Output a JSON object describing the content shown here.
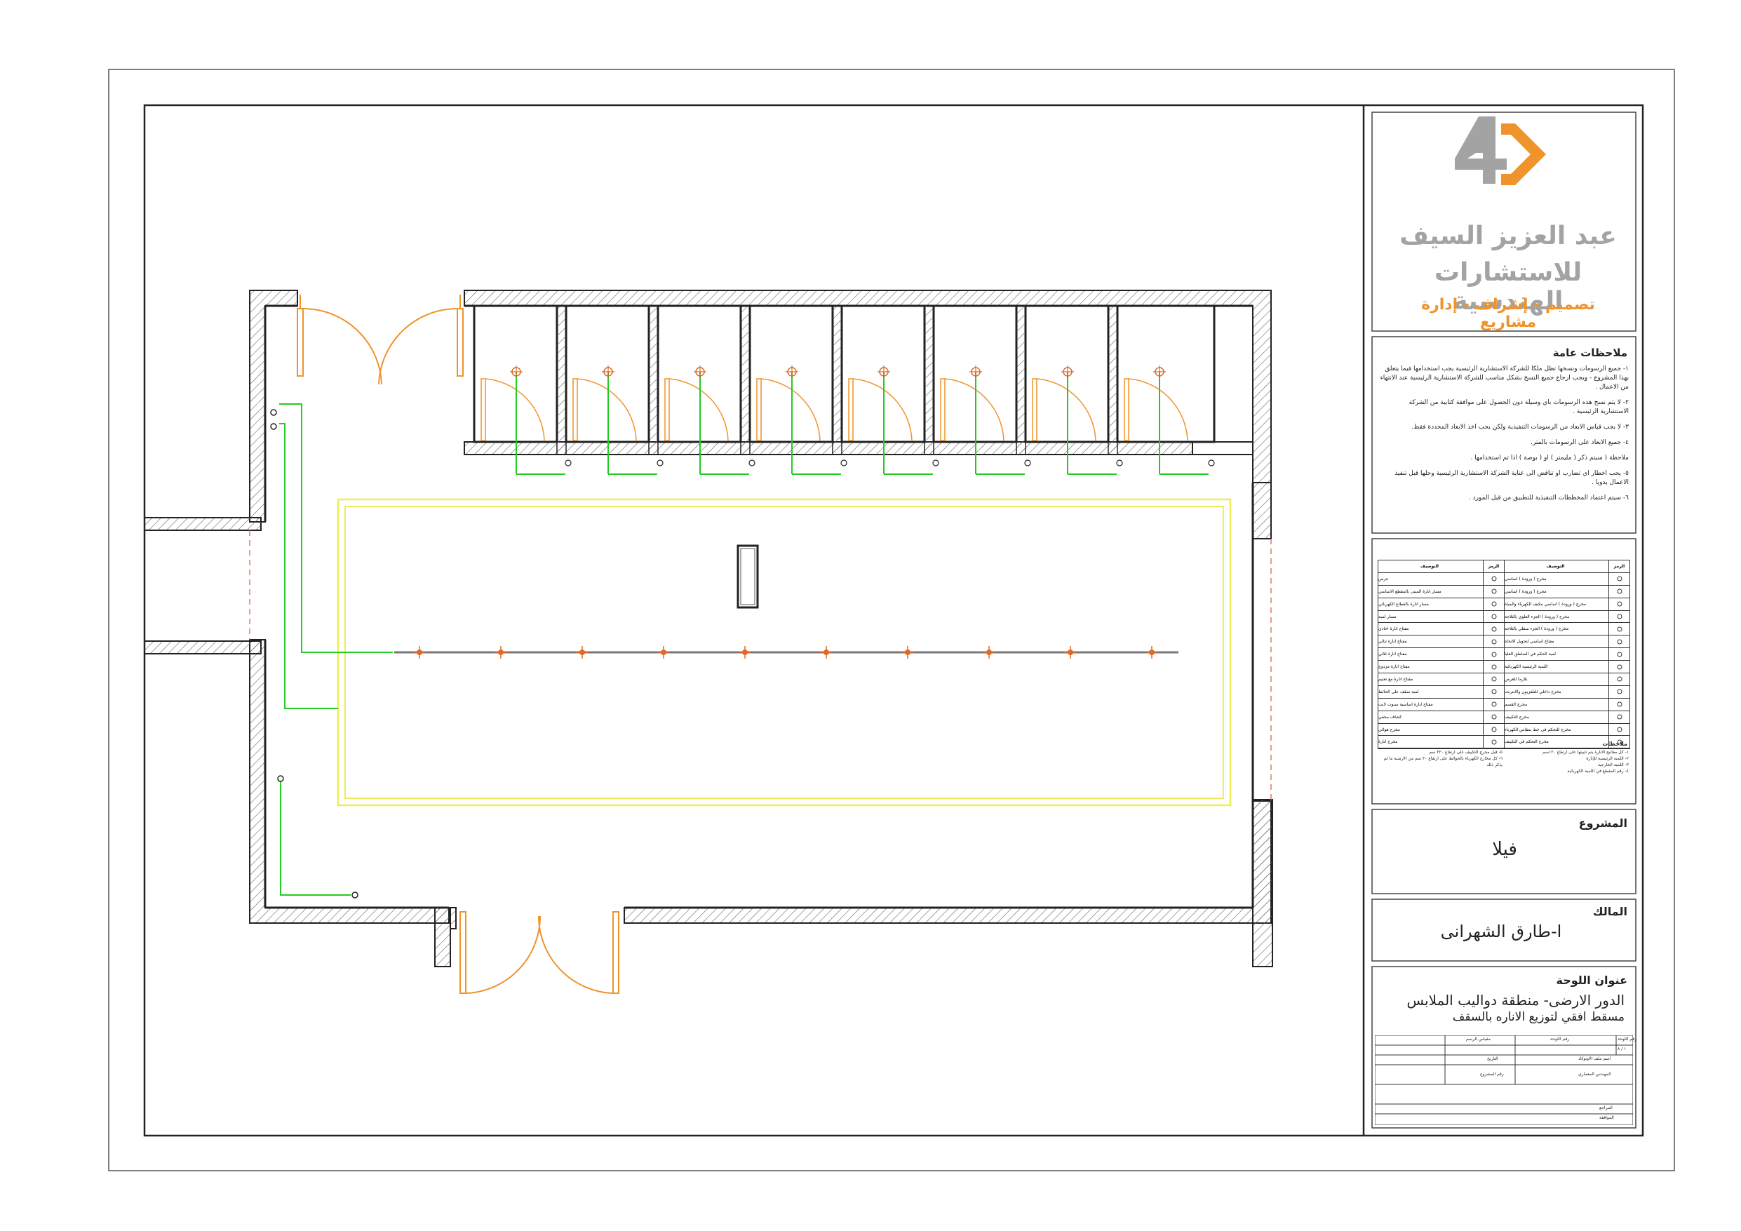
{
  "company": {
    "name_line1": "عبد العزيز السيف",
    "name_line2": "للاستشارات الهندسية",
    "services": "تصميم - إشراف - إدارة مشاريع",
    "logo_icon": "4d-logo-icon",
    "colors": {
      "brand_orange": "#f0932b",
      "brand_gray": "#a3a3a3"
    }
  },
  "notes": {
    "title": "ملاحظات عامة",
    "items": [
      "١- جميع الرسومات ونسخها تظل ملكا للشركة الاستشارية الرئيسية يجب استخدامها فيما يتعلق بهذا المشروع - ويجب ارجاع جميع النسخ بشكل مناسب للشركة الاستشارية الرئيسية عند الانتهاء من الاعمال .",
      "٢- لا يتم نسخ هذه الرسومات باي وسيلة دون الحصول على موافقة كتابية من الشركة الاستشارية الرئيسية .",
      "٣- لا يجب قياس الابعاد من الرسومات التنفيذية ولكن يجب اخذ الابعاد المحددة فقط.",
      "٤- جميع الابعاد على الرسومات بالمتر.",
      "ملاحظة ( سيتم ذكر ( مليمتر ) او ( بوصة ) اذا تم استخدامها .",
      "٥- يجب اخطار اي تضارب او تناقض الى عناية الشركة الاستشارية الرئيسية وحلها قبل تنفيذ الاعمال يدويا .",
      "٦- سيتم اعتماد المخططات التنفيذية للتطبيق من قبل المورد ."
    ]
  },
  "legend": {
    "header_symbol": "الرمز",
    "header_description": "التوصيف",
    "right_rows": [
      "مخرج ( ورودة ) اساسي",
      "مخرج ( ورودة ) اساسي",
      "مخرج ( ورودة ) اساسي مكيف للكهرباء والمياه",
      "مخرج ( ورودة ) الجزء العلوي بالثلاجة",
      "مخرج ( ورودة ) الجزء سفلي بالثلاجة",
      "مفتاح اساسي لتحويل الاتجاه",
      "لمبة الحكم في المناطق العليا",
      "اللمبة الرئيسية الكهربائية",
      "بلازما للعرض",
      "مخرج داخلي للتلفزيون والانترنت",
      "مخرج القسم",
      "مخرج للتكييف",
      "مخرج للتحكم في خط بمقاس الكهرباء",
      "مخرج التحكم في التكييف"
    ],
    "left_rows": [
      "جرس",
      "مسار انارة المبنى بالمقطع الاساسي",
      "مسار انارة بالقطاع الكهربائي",
      "مسار لمبة",
      "مفتاح انارة احادي",
      "مفتاح انارة ثنائي",
      "مفتاح انارة ثلاثي",
      "مفتاح انارة مزدوج",
      "مفتاح انارة مع تعتيم",
      "لمبة سقف على الحائط",
      "مفتاح انارة اساسية سبوت لايت",
      "كشاف مخفي",
      "مخرج هوائي",
      "مخرج انارة"
    ],
    "footnotes_title": "ملاحظات",
    "footnotes_right": [
      "١- كل مفاتيح الانارة يتم تثبيتها على ارتفاع ١٢٠سم",
      "٢- اللمبة الرئيسية للإنارة",
      "٣- اللمبة الخارجية",
      "٤- رقم المقطع في اللمبة الكهربائية"
    ],
    "footnotes_left": [
      "٥- قبل مخرج التكييف على ارتفاع ٢٢٠ سم",
      "٦- كل مخارج الكهرباء بالحوائط على ارتفاع ٣٠ سم من الارضية ما لم يذكر ذلك"
    ]
  },
  "project": {
    "label": "المشروع",
    "value": "فيلا"
  },
  "owner": {
    "label": "المالك",
    "value": "ا-طارق الشهرانى"
  },
  "sheet_title": {
    "label": "عنوان اللوحة",
    "line1": "الدور الارضى- منطقة دواليب الملابس",
    "line2": "مسقط افقي لتوزيع الاناره بالسقف"
  },
  "sheet_info": {
    "sheet_no_label": "رقم اللوحة",
    "sheet_no_value": "١ / ٨",
    "drawing_no_label": "رقم اللوحة",
    "scale_label": "مقياس الرسم",
    "file_name_label": "اسم ملف الاوتوكاد",
    "date_label": "التاريخ",
    "engineer_label": "المهندس المعماري",
    "project_no_label": "رقم المشروع",
    "reviewer_label": "المراجع",
    "approval_label": "الموافقة"
  },
  "plan": {
    "closets_count": 8,
    "ceiling_lights_count": 10,
    "colors": {
      "wall": "#222222",
      "hatch": "#555555",
      "door": "#f0932b",
      "wiring": "#22cc22",
      "ceiling_cove": "#eeee55",
      "light": "#dd6a2a",
      "frame": "#333333"
    }
  }
}
